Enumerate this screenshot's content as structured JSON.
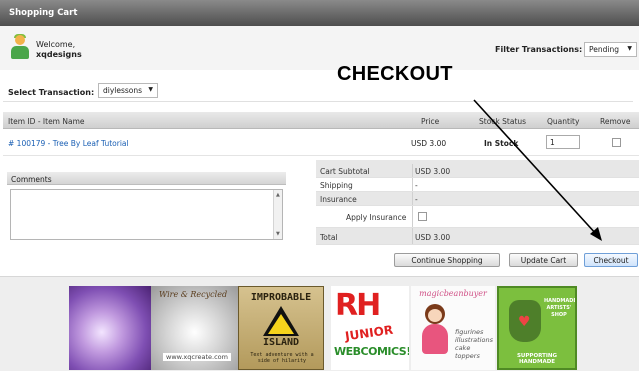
{
  "window": {
    "title": "Shopping Cart"
  },
  "welcome": {
    "greeting": "Welcome,",
    "username": "xqdesigns"
  },
  "filter": {
    "label": "Filter Transactions:",
    "selected": "Pending"
  },
  "annotation": {
    "text": "CHECKOUT"
  },
  "transaction": {
    "label": "Select Transaction:",
    "selected": "diylessons"
  },
  "cart_table": {
    "headers": [
      "Item ID - Item Name",
      "Price",
      "Stock Status",
      "Quantity",
      "Remove"
    ],
    "rows": [
      {
        "item": "# 100179 - Tree By Leaf Tutorial",
        "price": "USD 3.00",
        "stock": "In Stock",
        "quantity": "1"
      }
    ]
  },
  "comments": {
    "label": "Comments"
  },
  "totals": {
    "subtotal_label": "Cart Subtotal",
    "subtotal_value": "USD 3.00",
    "shipping_label": "Shipping",
    "shipping_value": "-",
    "insurance_label": "Insurance",
    "insurance_value": "-",
    "apply_insurance_label": "Apply Insurance",
    "total_label": "Total",
    "total_value": "USD 3.00"
  },
  "buttons": {
    "continue_shopping": "Continue Shopping",
    "update_cart": "Update Cart",
    "checkout": "Checkout"
  },
  "banners": {
    "ad2_title": "Wire & Recycled",
    "ad2_url": "www.xqcreate.com",
    "ad3_line1": "IMPROBABLE",
    "ad3_line2": "ISLAND",
    "ad3_tagline": "Text adventure with a side of hilarity",
    "ad4_line1": "RH",
    "ad4_line2": "JUNIOR",
    "ad4_line3": "WEBCOMICS!",
    "ad5_title": "magicbeanbuyer",
    "ad5_text": "figurines\nillustrations\ncake toppers",
    "ad6_top": "HANDMADE ARTISTS' SHOP",
    "ad6_bottom": "SUPPORTING HANDMADE"
  },
  "colors": {
    "link": "#1a5fb4",
    "titlebar": "#5a5a5a",
    "checkout_button": "#cfe3fb"
  }
}
